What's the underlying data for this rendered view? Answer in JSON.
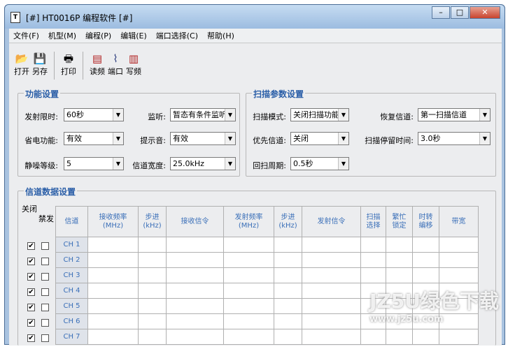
{
  "window": {
    "title": "[#] HT0016P 编程软件 [#]",
    "controls": {
      "minimize": "–",
      "maximize": "□",
      "close": "✕"
    }
  },
  "menu": [
    "文件(F)",
    "机型(M)",
    "编程(P)",
    "编辑(E)",
    "端口选择(C)",
    "帮助(H)"
  ],
  "toolbar": {
    "open": "打开",
    "saveas": "另存",
    "print": "打印",
    "read": "读频",
    "port": "端口",
    "write": "写频"
  },
  "function_settings": {
    "title": "功能设置",
    "tx_limit": {
      "label": "发射限时:",
      "value": "60秒"
    },
    "monitor": {
      "label": "监听:",
      "value": "暂态有条件监听"
    },
    "power_save": {
      "label": "省电功能:",
      "value": "有效"
    },
    "beep": {
      "label": "提示音:",
      "value": "有效"
    },
    "squelch": {
      "label": "静噪等级:",
      "value": "5"
    },
    "bandwidth": {
      "label": "信道宽度:",
      "value": "25.0kHz"
    }
  },
  "scan_settings": {
    "title": "扫描参数设置",
    "scan_mode": {
      "label": "扫描模式:",
      "value": "关闭扫描功能"
    },
    "restore_channel": {
      "label": "恢复信道:",
      "value": "第一扫描信道"
    },
    "priority_channel": {
      "label": "优先信道:",
      "value": "关闭"
    },
    "scan_dwell": {
      "label": "扫描停留时间:",
      "value": "3.0秒"
    },
    "scan_back": {
      "label": "回扫周期:",
      "value": "0.5秒"
    }
  },
  "channel_data": {
    "title": "信道数据设置",
    "check_labels": {
      "close": "关闭",
      "disable_tx": "禁发"
    },
    "columns": [
      "信道",
      "接收频率\n(MHz)",
      "步进\n(kHz)",
      "接收信令",
      "发射频率\n(MHz)",
      "步进\n(kHz)",
      "发射信令",
      "扫描\n选择",
      "繁忙\n锁定",
      "时转\n编移",
      "带宽"
    ],
    "rows": [
      "CH 1",
      "CH 2",
      "CH 3",
      "CH 4",
      "CH 5",
      "CH 6",
      "CH 7"
    ]
  },
  "watermark": {
    "main": "JZ5U绿色下载",
    "url": "www.jz5u.com"
  }
}
